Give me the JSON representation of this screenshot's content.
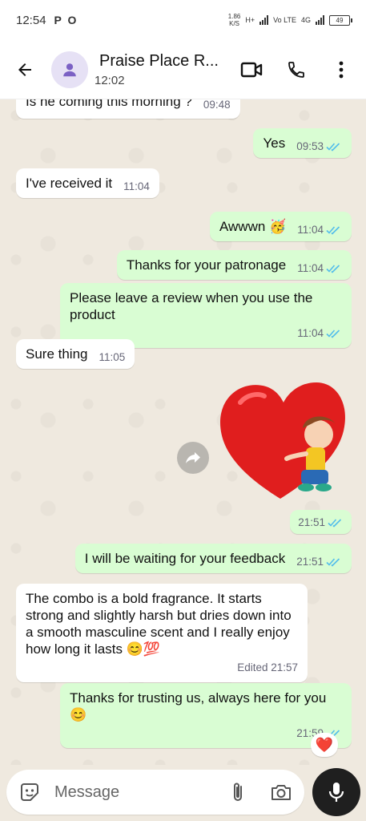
{
  "status_bar": {
    "time": "12:54",
    "left_icons": "P O",
    "net_speed": "1.86",
    "net_unit": "K/S",
    "net_type_1": "H+",
    "net_type_2": "Vo LTE",
    "net_type_3": "4G",
    "battery": "49"
  },
  "header": {
    "contact_name": "Praise Place R...",
    "subtitle": "12:02",
    "icons": [
      "back-arrow-icon",
      "contact-avatar-icon",
      "video-call-icon",
      "phone-icon",
      "more-vert-icon"
    ]
  },
  "messages": [
    {
      "id": "m1",
      "dir": "in",
      "text": "Is he coming this morning ?",
      "time": "09:48"
    },
    {
      "id": "m2",
      "dir": "out",
      "text": "Yes",
      "time": "09:53",
      "status": "read"
    },
    {
      "id": "m3",
      "dir": "in",
      "text": "I've received it",
      "time": "11:04"
    },
    {
      "id": "m4",
      "dir": "out",
      "text": "Awwwn",
      "emoji": "🥳",
      "time": "11:04",
      "status": "read"
    },
    {
      "id": "m5",
      "dir": "out",
      "text": "Thanks for your patronage",
      "time": "11:04",
      "status": "read"
    },
    {
      "id": "m6",
      "dir": "out",
      "text": "Please leave a review when you use the product",
      "time": "11:04",
      "status": "read"
    },
    {
      "id": "m7",
      "dir": "in",
      "text": "Sure thing",
      "time": "11:05"
    },
    {
      "id": "m8",
      "dir": "out",
      "type": "sticker",
      "sticker": "boy-hugging-heart",
      "time": "21:51",
      "status": "read"
    },
    {
      "id": "m9",
      "dir": "out",
      "text": "I will be waiting for your feedback",
      "time": "21:51",
      "status": "read"
    },
    {
      "id": "m10",
      "dir": "in",
      "text": "The combo is a bold fragrance. It starts strong and slightly harsh but dries down into a smooth masculine scent and I really enjoy how long it lasts",
      "emoji": "😊💯",
      "time": "Edited 21:57"
    },
    {
      "id": "m11",
      "dir": "out",
      "text": "Thanks for trusting us, always here for you",
      "emoji": "😊",
      "time": "21:59",
      "status": "read",
      "reaction": "❤️"
    }
  ],
  "composer": {
    "placeholder": "Message",
    "icons": [
      "sticker-icon",
      "attach-icon",
      "camera-icon",
      "mic-icon"
    ]
  },
  "colors": {
    "outgoing_bubble": "#d9fdd3",
    "incoming_bubble": "#ffffff",
    "read_tick": "#53bdeb",
    "chat_bg": "#efe9df",
    "avatar_bg": "#e6e1f5",
    "avatar_icon": "#7b61c4"
  }
}
